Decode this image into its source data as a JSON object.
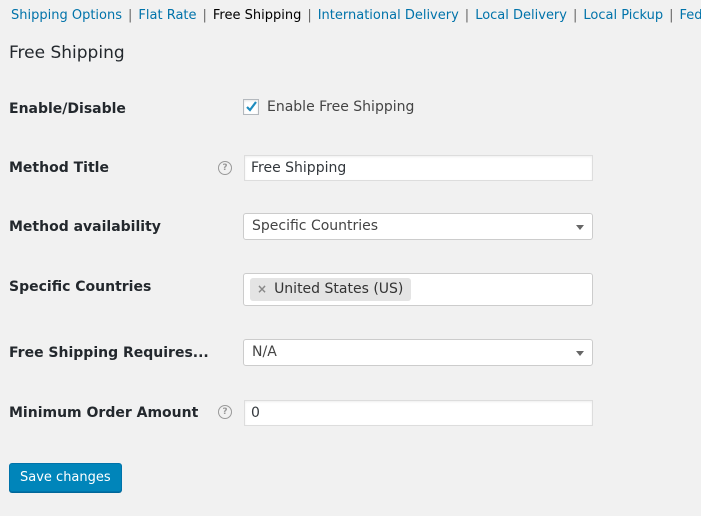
{
  "nav": {
    "items": [
      {
        "label": "Shipping Options",
        "current": false
      },
      {
        "label": "Flat Rate",
        "current": false
      },
      {
        "label": "Free Shipping",
        "current": true
      },
      {
        "label": "International Delivery",
        "current": false
      },
      {
        "label": "Local Delivery",
        "current": false
      },
      {
        "label": "Local Pickup",
        "current": false
      },
      {
        "label": "FedEx",
        "current": false
      }
    ],
    "separator": "|"
  },
  "page": {
    "title": "Free Shipping"
  },
  "form": {
    "enable": {
      "label": "Enable/Disable",
      "checkbox_label": "Enable Free Shipping",
      "checked": true
    },
    "method_title": {
      "label": "Method Title",
      "help_icon": "?",
      "value": "Free Shipping"
    },
    "availability": {
      "label": "Method availability",
      "value": "Specific Countries"
    },
    "specific_countries": {
      "label": "Specific Countries",
      "chip_remove": "×",
      "selected": "United States (US)"
    },
    "requires": {
      "label": "Free Shipping Requires...",
      "value": "N/A"
    },
    "min_amount": {
      "label": "Minimum Order Amount",
      "help_icon": "?",
      "value": "0"
    }
  },
  "actions": {
    "save_label": "Save changes"
  },
  "colors": {
    "link": "#0073aa",
    "button": "#0085ba",
    "checkmark": "#1e8cbe",
    "background": "#f1f1f1"
  }
}
